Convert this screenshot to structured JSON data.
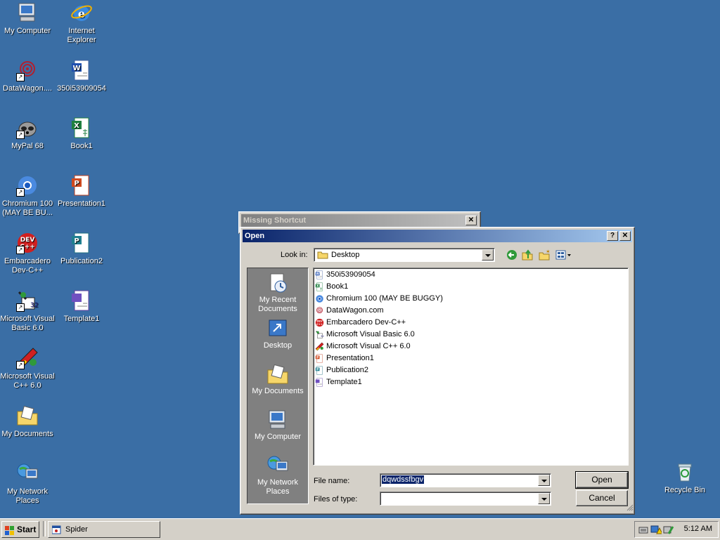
{
  "desktop": {
    "icons_left": [
      {
        "label": "My Computer",
        "icon": "my-computer-icon"
      },
      {
        "label": "DataWagon....",
        "icon": "datawagon-icon"
      },
      {
        "label": "MyPal 68",
        "icon": "mypal-icon"
      },
      {
        "label": "Chromium 100 (MAY BE BU...",
        "icon": "chromium-icon"
      },
      {
        "label": "Embarcadero Dev-C++",
        "icon": "devcpp-icon"
      },
      {
        "label": "Microsoft Visual Basic 6.0",
        "icon": "vb6-icon"
      },
      {
        "label": "Microsoft Visual C++ 6.0",
        "icon": "vcpp-icon"
      },
      {
        "label": "My Documents",
        "icon": "my-documents-icon"
      },
      {
        "label": "My Network Places",
        "icon": "network-places-icon"
      }
    ],
    "icons_right": [
      {
        "label": "Internet Explorer",
        "icon": "internet-explorer-icon"
      },
      {
        "label": "350i53909054",
        "icon": "word-doc-icon"
      },
      {
        "label": "Book1",
        "icon": "excel-icon"
      },
      {
        "label": "Presentation1",
        "icon": "powerpoint-icon"
      },
      {
        "label": "Publication2",
        "icon": "publisher-icon"
      },
      {
        "label": "Template1",
        "icon": "template-icon"
      }
    ],
    "recycle_bin": "Recycle Bin"
  },
  "missing_shortcut": {
    "title": "Missing Shortcut"
  },
  "open_dialog": {
    "title": "Open",
    "help_btn": "?",
    "close_btn": "✕",
    "look_in_label": "Look in:",
    "look_in_value": "Desktop",
    "places": [
      "My Recent Documents",
      "Desktop",
      "My Documents",
      "My Computer",
      "My Network Places"
    ],
    "files": [
      {
        "name": "350i53909054",
        "icon": "word-doc-icon"
      },
      {
        "name": "Book1",
        "icon": "excel-icon"
      },
      {
        "name": "Chromium 100 (MAY BE BUGGY)",
        "icon": "chromium-icon"
      },
      {
        "name": "DataWagon.com",
        "icon": "datawagon-icon"
      },
      {
        "name": "Embarcadero Dev-C++",
        "icon": "devcpp-icon"
      },
      {
        "name": "Microsoft Visual Basic 6.0",
        "icon": "vb6-icon"
      },
      {
        "name": "Microsoft Visual C++ 6.0",
        "icon": "vcpp-icon"
      },
      {
        "name": "Presentation1",
        "icon": "powerpoint-icon"
      },
      {
        "name": "Publication2",
        "icon": "publisher-icon"
      },
      {
        "name": "Template1",
        "icon": "template-icon"
      }
    ],
    "file_name_label": "File name:",
    "file_name_value": "dqwdssfbgv",
    "files_of_type_label": "Files of type:",
    "files_of_type_value": "",
    "open_btn": "Open",
    "cancel_btn": "Cancel"
  },
  "taskbar": {
    "start": "Start",
    "task": "Spider",
    "clock": "5:12 AM"
  },
  "colors": {
    "desktop": "#3a6ea5",
    "title_active": "#0a246a",
    "face": "#d4d0c8"
  }
}
